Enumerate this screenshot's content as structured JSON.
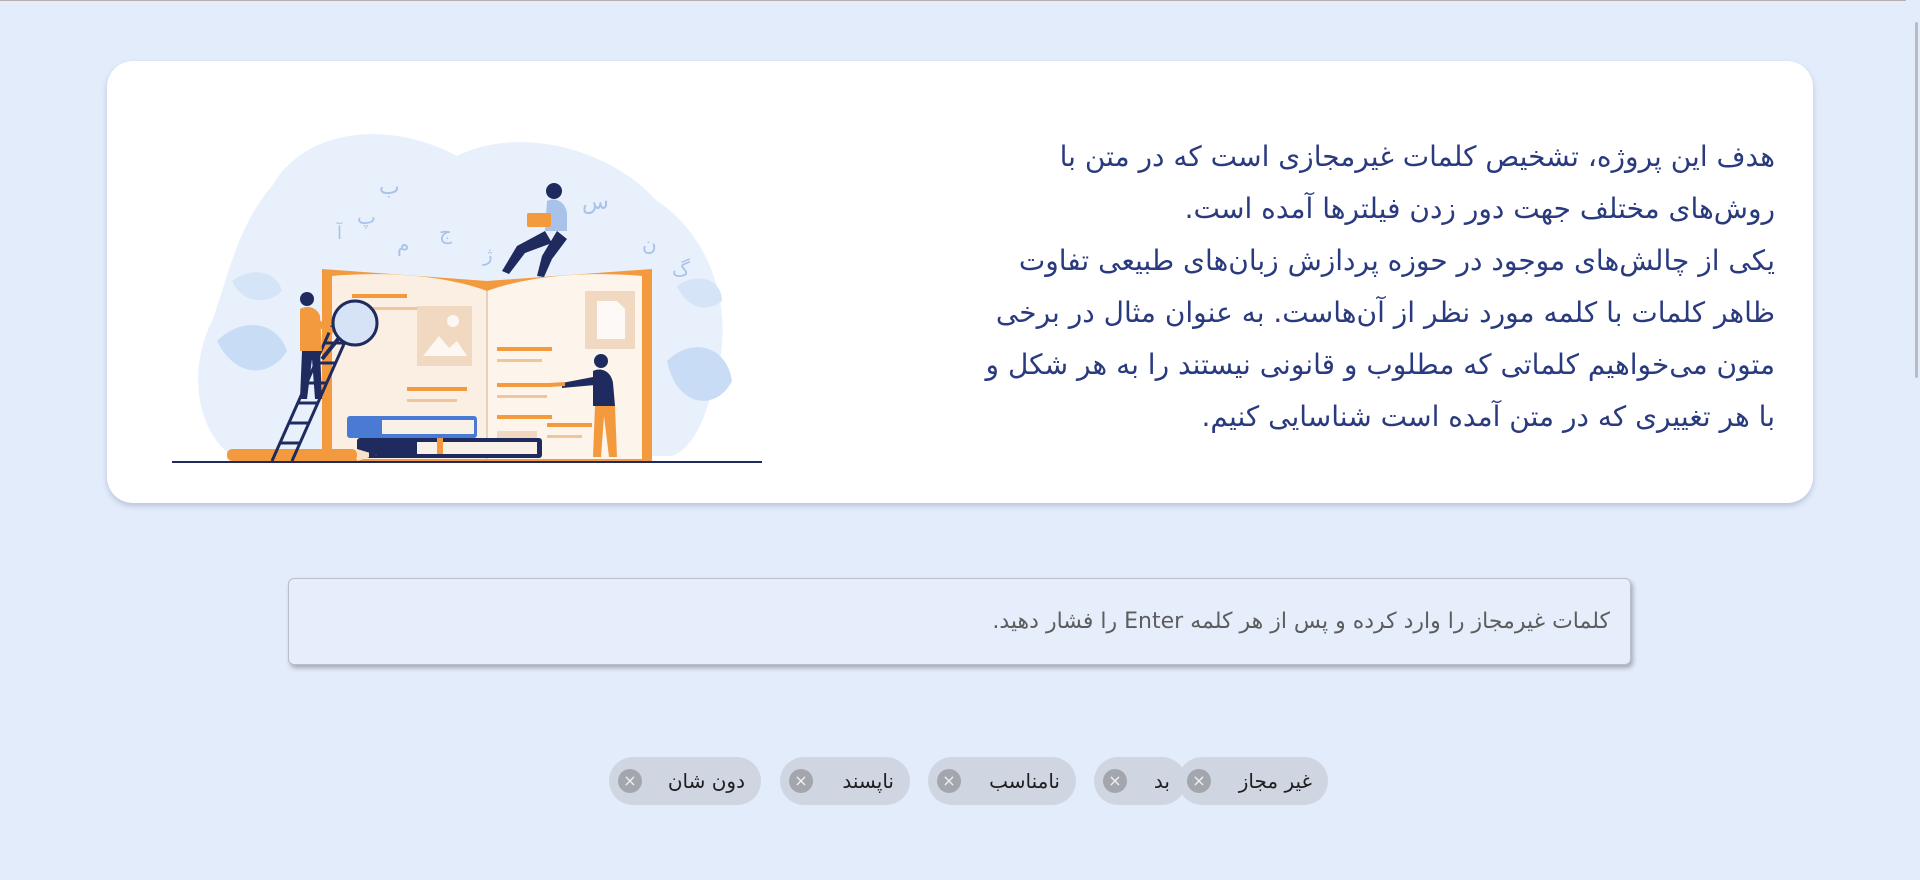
{
  "intro": {
    "paragraphs": [
      "هدف این پروژه، تشخیص کلمات غیرمجازی است که در متن با روش‌های مختلف جهت دور زدن فیلترها آمده است.",
      "یکی از چالش‌های موجود در حوزه پردازش زبان‌های طبیعی تفاوت ظاهر کلمات با کلمه مورد نظر از آن‌هاست. به عنوان مثال در برخی متون می‌خواهیم کلماتی که مطلوب و قانونی نیستند را به هر شکل و با هر تغییری که در متن آمده است شناسایی کنیم."
    ],
    "illustration_letters": [
      "ب",
      "پ",
      "آ",
      "م",
      "ج",
      "ژ",
      "س",
      "ن",
      "گ"
    ]
  },
  "word_input": {
    "placeholder": "کلمات غیرمجاز را وارد کرده و پس از هر کلمه Enter را فشار دهید.",
    "value": ""
  },
  "tags": [
    {
      "label": "غیر مجاز"
    },
    {
      "label": "بد"
    },
    {
      "label": "نامناسب"
    },
    {
      "label": "ناپسند"
    },
    {
      "label": "دون شان"
    }
  ],
  "tag_close_glyph": "×",
  "colors": {
    "page_background": "#e3ecfb",
    "card_background": "#ffffff",
    "text": "#2a3a7f",
    "tag_background": "#cfd6e2",
    "accent_orange": "#f39a3e",
    "accent_navy": "#1f2b5e"
  }
}
